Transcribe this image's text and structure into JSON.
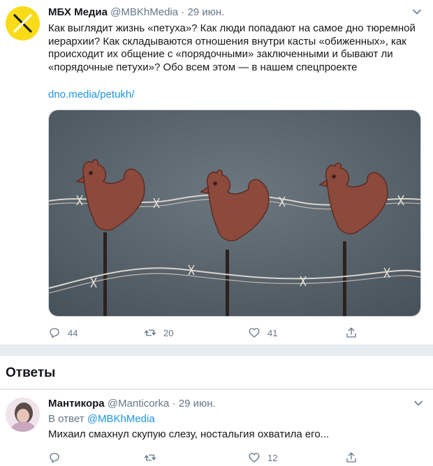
{
  "tweet": {
    "author_name": "МБХ Медиа",
    "author_handle": "@MBKhMedia",
    "separator": "·",
    "date": "29 июн.",
    "text": "Как выглядит жизнь «петуха»? Как люди попадают на самое дно тюремной иерархии? Как складываются отношения внутри касты «обиженных», как происходит их общение с «порядочными» заключенными и бывают ли «порядочные петухи»? Обо всем этом — в нашем спецпроекте",
    "link": "dno.media/petukh/",
    "replies_count": "44",
    "retweets_count": "20",
    "likes_count": "41"
  },
  "answers": {
    "title": "Ответы"
  },
  "reply": {
    "author_name": "Мантикора",
    "author_handle": "@Manticorka",
    "separator": "·",
    "date": "29 июн.",
    "reply_to_label": "В ответ",
    "reply_to_handle": "@MBKhMedia",
    "text": "Михаил смахнул скупую слезу, ностальгия охватила его...",
    "replies_count": "",
    "retweets_count": "",
    "likes_count": "12"
  },
  "colors": {
    "accent": "#1b95e0",
    "muted": "#657786",
    "brand_yellow": "#f8dc1a",
    "image_bg": "#5a6670",
    "rooster": "#8c4a3c"
  },
  "icons": {
    "reply": "reply-icon",
    "retweet": "retweet-icon",
    "like": "heart-icon",
    "share": "share-icon",
    "more": "chevron-down-icon"
  }
}
